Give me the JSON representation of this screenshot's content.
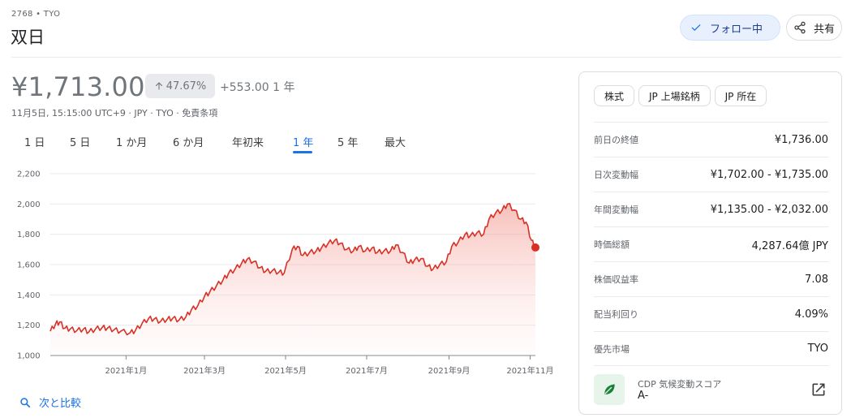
{
  "header": {
    "ticker": "2768 • TYO",
    "company": "双日",
    "follow_label": "フォロー中",
    "share_label": "共有"
  },
  "quote": {
    "price": "¥1,713.00",
    "percent_change": "47.67%",
    "abs_change": "+553.00 1 年",
    "meta": "11月5日, 15:15:00 UTC+9 · JPY · TYO · 免責条項"
  },
  "tabs": [
    {
      "label": "1 日"
    },
    {
      "label": "5 日"
    },
    {
      "label": "1 か月"
    },
    {
      "label": "6 か月"
    },
    {
      "label": "年初来"
    },
    {
      "label": "1 年",
      "active": true
    },
    {
      "label": "5 年"
    },
    {
      "label": "最大"
    }
  ],
  "compare_label": "次と比較",
  "colors": {
    "accent": "#1a73e8",
    "line": "#d93025",
    "follow_bg": "#e8f0fe"
  },
  "chart_data": {
    "type": "area",
    "yticks": [
      "2,200",
      "2,000",
      "1,800",
      "1,600",
      "1,400",
      "1,200",
      "1,000"
    ],
    "ylim": [
      1000,
      2200
    ],
    "xticks": [
      "2021年1月",
      "2021年3月",
      "2021年5月",
      "2021年7月",
      "2021年9月",
      "2021年11月"
    ],
    "x_tick_dates": [
      "2021-01-01",
      "2021-03-01",
      "2021-05-01",
      "2021-07-01",
      "2021-09-01",
      "2021-11-01"
    ],
    "x_range": [
      "2020-11-05",
      "2021-11-05"
    ],
    "series": [
      {
        "points": [
          [
            "2020-11-05",
            1160
          ],
          [
            "2020-11-09",
            1210
          ],
          [
            "2020-11-12",
            1220
          ],
          [
            "2020-11-16",
            1180
          ],
          [
            "2020-11-20",
            1175
          ],
          [
            "2020-11-25",
            1165
          ],
          [
            "2020-11-30",
            1175
          ],
          [
            "2020-12-04",
            1155
          ],
          [
            "2020-12-09",
            1175
          ],
          [
            "2020-12-14",
            1185
          ],
          [
            "2020-12-18",
            1180
          ],
          [
            "2020-12-23",
            1170
          ],
          [
            "2020-12-28",
            1160
          ],
          [
            "2021-01-04",
            1150
          ],
          [
            "2021-01-08",
            1165
          ],
          [
            "2021-01-13",
            1210
          ],
          [
            "2021-01-18",
            1245
          ],
          [
            "2021-01-22",
            1240
          ],
          [
            "2021-01-27",
            1225
          ],
          [
            "2021-02-01",
            1240
          ],
          [
            "2021-02-05",
            1245
          ],
          [
            "2021-02-10",
            1235
          ],
          [
            "2021-02-15",
            1255
          ],
          [
            "2021-02-19",
            1300
          ],
          [
            "2021-02-24",
            1330
          ],
          [
            "2021-03-01",
            1390
          ],
          [
            "2021-03-05",
            1420
          ],
          [
            "2021-03-10",
            1460
          ],
          [
            "2021-03-15",
            1500
          ],
          [
            "2021-03-19",
            1540
          ],
          [
            "2021-03-24",
            1570
          ],
          [
            "2021-03-29",
            1610
          ],
          [
            "2021-04-02",
            1635
          ],
          [
            "2021-04-07",
            1620
          ],
          [
            "2021-04-12",
            1580
          ],
          [
            "2021-04-16",
            1555
          ],
          [
            "2021-04-21",
            1560
          ],
          [
            "2021-04-26",
            1550
          ],
          [
            "2021-04-30",
            1545
          ],
          [
            "2021-05-06",
            1700
          ],
          [
            "2021-05-10",
            1720
          ],
          [
            "2021-05-14",
            1660
          ],
          [
            "2021-05-19",
            1680
          ],
          [
            "2021-05-24",
            1690
          ],
          [
            "2021-05-28",
            1710
          ],
          [
            "2021-06-02",
            1740
          ],
          [
            "2021-06-07",
            1760
          ],
          [
            "2021-06-11",
            1740
          ],
          [
            "2021-06-16",
            1700
          ],
          [
            "2021-06-21",
            1690
          ],
          [
            "2021-06-25",
            1720
          ],
          [
            "2021-06-30",
            1690
          ],
          [
            "2021-07-05",
            1710
          ],
          [
            "2021-07-09",
            1680
          ],
          [
            "2021-07-14",
            1690
          ],
          [
            "2021-07-19",
            1690
          ],
          [
            "2021-07-23",
            1730
          ],
          [
            "2021-07-28",
            1680
          ],
          [
            "2021-08-02",
            1610
          ],
          [
            "2021-08-06",
            1630
          ],
          [
            "2021-08-11",
            1640
          ],
          [
            "2021-08-16",
            1590
          ],
          [
            "2021-08-20",
            1570
          ],
          [
            "2021-08-25",
            1600
          ],
          [
            "2021-08-30",
            1620
          ],
          [
            "2021-09-03",
            1720
          ],
          [
            "2021-09-08",
            1750
          ],
          [
            "2021-09-13",
            1800
          ],
          [
            "2021-09-17",
            1790
          ],
          [
            "2021-09-22",
            1810
          ],
          [
            "2021-09-27",
            1800
          ],
          [
            "2021-10-01",
            1900
          ],
          [
            "2021-10-06",
            1940
          ],
          [
            "2021-10-11",
            1960
          ],
          [
            "2021-10-15",
            2000
          ],
          [
            "2021-10-20",
            1960
          ],
          [
            "2021-10-25",
            1900
          ],
          [
            "2021-10-29",
            1880
          ],
          [
            "2021-11-02",
            1760
          ],
          [
            "2021-11-05",
            1713
          ]
        ]
      }
    ],
    "grid": true
  },
  "stats": {
    "chips": [
      "株式",
      "JP 上場銘柄",
      "JP 所在"
    ],
    "rows": [
      {
        "label": "前日の終値",
        "value": "¥1,736.00"
      },
      {
        "label": "日次変動幅",
        "value": "¥1,702.00 - ¥1,735.00"
      },
      {
        "label": "年間変動幅",
        "value": "¥1,135.00 - ¥2,032.00"
      },
      {
        "label": "時価総額",
        "value": "4,287.64億 JPY"
      },
      {
        "label": "株価収益率",
        "value": "7.08"
      },
      {
        "label": "配当利回り",
        "value": "4.09%"
      },
      {
        "label": "優先市場",
        "value": "TYO"
      }
    ],
    "cdp_label": "CDP 気候変動スコア",
    "cdp_value": "A-"
  }
}
